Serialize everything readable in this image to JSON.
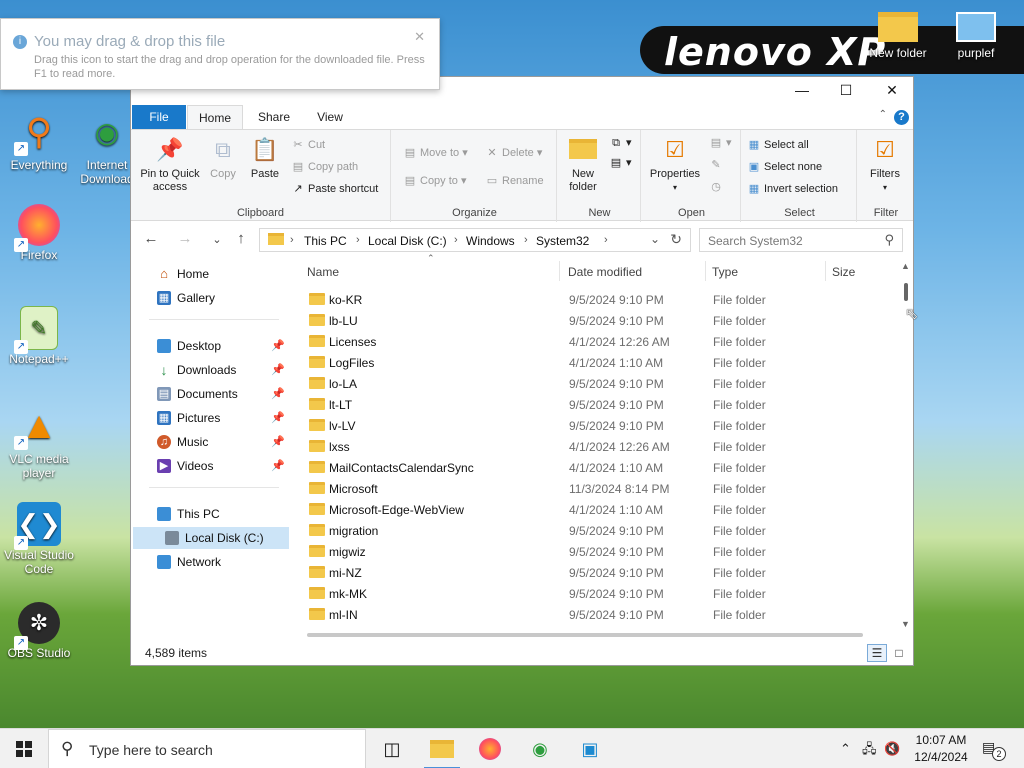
{
  "desktop": {
    "logo_text": "lenovo XP",
    "icons": [
      {
        "label": "Everything"
      },
      {
        "label": "Internet Download"
      },
      {
        "label": "Firefox"
      },
      {
        "label": "Notepad++"
      },
      {
        "label": "VLC media player"
      },
      {
        "label": "Visual Studio Code"
      },
      {
        "label": "OBS Studio"
      }
    ],
    "top_icons": [
      {
        "label": "New folder"
      },
      {
        "label": "purplef"
      }
    ]
  },
  "tooltip": {
    "title": "You may drag & drop this file",
    "body": "Drag this icon to start the drag and drop operation for the downloaded file. Press F1 to read more."
  },
  "explorer": {
    "tabs": [
      "File",
      "Home",
      "Share",
      "View"
    ],
    "ribbon": {
      "clipboard": {
        "pin": "Pin to Quick access",
        "copy": "Copy",
        "paste": "Paste",
        "cut": "Cut",
        "copy_path": "Copy path",
        "paste_shortcut": "Paste shortcut",
        "label": "Clipboard"
      },
      "organize": {
        "move_to": "Move to",
        "copy_to": "Copy to",
        "delete": "Delete",
        "rename": "Rename",
        "label": "Organize"
      },
      "new": {
        "new_folder": "New folder",
        "label": "New"
      },
      "open": {
        "properties": "Properties",
        "label": "Open"
      },
      "select": {
        "select_all": "Select all",
        "select_none": "Select none",
        "invert": "Invert selection",
        "label": "Select"
      },
      "filter": {
        "filters": "Filters",
        "label": "Filter"
      }
    },
    "breadcrumb": [
      "This PC",
      "Local Disk (C:)",
      "Windows",
      "System32"
    ],
    "search_placeholder": "Search System32",
    "nav": {
      "home": "Home",
      "gallery": "Gallery",
      "desktop": "Desktop",
      "downloads": "Downloads",
      "documents": "Documents",
      "pictures": "Pictures",
      "music": "Music",
      "videos": "Videos",
      "this_pc": "This PC",
      "local_disk": "Local Disk (C:)",
      "network": "Network"
    },
    "columns": [
      "Name",
      "Date modified",
      "Type",
      "Size"
    ],
    "files": [
      {
        "name": "ko-KR",
        "date": "9/5/2024 9:10 PM",
        "type": "File folder"
      },
      {
        "name": "lb-LU",
        "date": "9/5/2024 9:10 PM",
        "type": "File folder"
      },
      {
        "name": "Licenses",
        "date": "4/1/2024 12:26 AM",
        "type": "File folder"
      },
      {
        "name": "LogFiles",
        "date": "4/1/2024 1:10 AM",
        "type": "File folder"
      },
      {
        "name": "lo-LA",
        "date": "9/5/2024 9:10 PM",
        "type": "File folder"
      },
      {
        "name": "lt-LT",
        "date": "9/5/2024 9:10 PM",
        "type": "File folder"
      },
      {
        "name": "lv-LV",
        "date": "9/5/2024 9:10 PM",
        "type": "File folder"
      },
      {
        "name": "lxss",
        "date": "4/1/2024 12:26 AM",
        "type": "File folder"
      },
      {
        "name": "MailContactsCalendarSync",
        "date": "4/1/2024 1:10 AM",
        "type": "File folder"
      },
      {
        "name": "Microsoft",
        "date": "11/3/2024 8:14 PM",
        "type": "File folder"
      },
      {
        "name": "Microsoft-Edge-WebView",
        "date": "4/1/2024 1:10 AM",
        "type": "File folder"
      },
      {
        "name": "migration",
        "date": "9/5/2024 9:10 PM",
        "type": "File folder"
      },
      {
        "name": "migwiz",
        "date": "9/5/2024 9:10 PM",
        "type": "File folder"
      },
      {
        "name": "mi-NZ",
        "date": "9/5/2024 9:10 PM",
        "type": "File folder"
      },
      {
        "name": "mk-MK",
        "date": "9/5/2024 9:10 PM",
        "type": "File folder"
      },
      {
        "name": "ml-IN",
        "date": "9/5/2024 9:10 PM",
        "type": "File folder"
      }
    ],
    "status_count": "4,589 items"
  },
  "taskbar": {
    "search_placeholder": "Type here to search",
    "time": "10:07 AM",
    "date": "12/4/2024",
    "notification_count": "2"
  },
  "colors": {
    "accent": "#1979ca",
    "folder": "#f3c84b",
    "selected": "#cce4f7"
  }
}
